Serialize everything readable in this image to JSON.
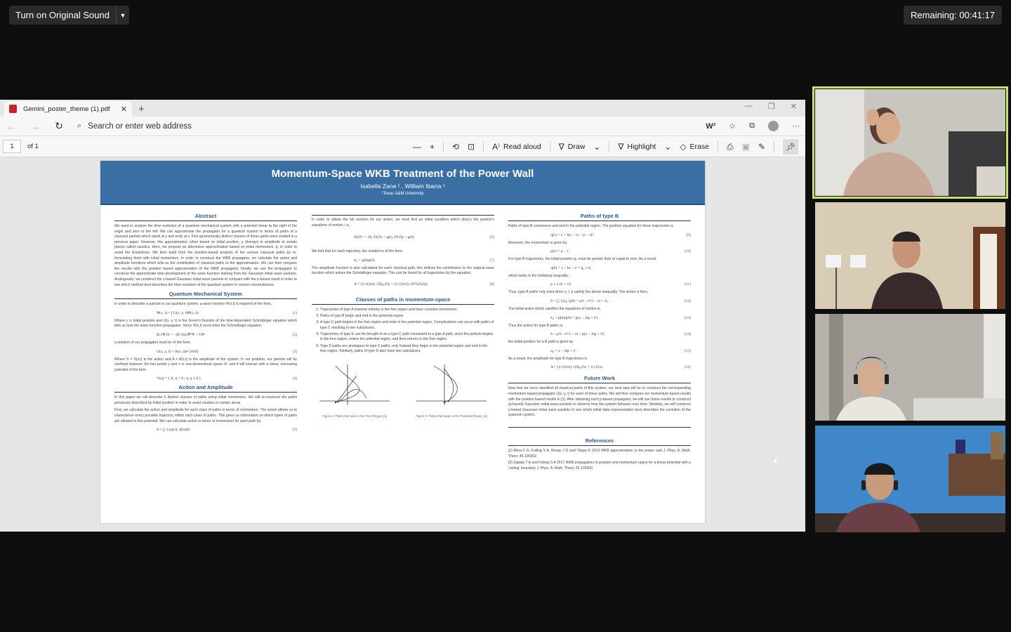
{
  "zoom": {
    "original_sound_label": "Turn on Original Sound",
    "remaining_label": "Remaining: 00:41:17"
  },
  "browser": {
    "tab_title": "Gemini_poster_theme (1).pdf",
    "address_placeholder": "Search or enter web address",
    "page_number": "1",
    "page_of": "of 1",
    "tools": {
      "read_aloud": "Read aloud",
      "draw": "Draw",
      "highlight": "Highlight",
      "erase": "Erase"
    }
  },
  "poster": {
    "title": "Momentum-Space WKB Treatment of the Power Wall",
    "authors": "Isabella Zane ¹ , William Ibarra ¹",
    "affiliation": "¹Texas A&M University",
    "sections": {
      "abstract": {
        "heading": "Abstract",
        "text": "We want to analyze the time evolution of a quantum mechanical system with a potential linear to the right of the origin and zero to the left. We can approximate the propagator for a quantum system in terms of paths of a classical particle which starts at y and ends at x. Five geometrically distinct classes of these paths were studied in a previous paper. However, this approximation, when based on initial position, y, diverges in amplitude at certain places called caustics. Here, we propose an alternative approximation based on initial momentum, p, in order to avoid the breakdown. We then build from the position-based analysis of the various classical paths by re-formulating them with initial momentum. In order to construct the WKB propagator, we calculate the action and amplitude functions which tells us the contribution of classical paths to the approximation. We can then compare the results with the position based approximation of the WKB propagator. Finally, we use the propagator to construct the approximate time-development of the wave function starting from the Gaussian initial wave packets. Analogously, we construct the y-based Gaussian initial wave packets to compare with the p-based result in order to see which method best describes the time evolution of the quantum system in various circumstances."
      },
      "qms": {
        "heading": "Quantum Mechanical System",
        "p1": "In order to describe a particle in our quantum system, a wave function Ψ(x,t) is required of the form,",
        "eq1": "Ψ(x, t) = ∫ U(x, y, t)Ψ(y, 0)",
        "eq1_n": "[1]",
        "p2": "Where y is initial position and U(x, y, t) is the Green's function of the time-dependent Schrödinger equation which tells us how the wave function propagates. Since Ψ(x,t) must solve the Schrödinger equation,",
        "eq2": "iħ ∂Ψ/∂t = −(ħ²/2m)∇²Ψ + VΨ",
        "eq2_n": "[2]",
        "p3": "a solution of our propagator must be of the form,",
        "eq3": "U(x, y, t) = A(x, t)e^{iS/ħ}",
        "eq3_n": "[3]",
        "p4": "Where S = S(x,t) is the action and A = A(x,t) is the amplitude of the system. In our problem, our particle will be confined between the two points y and x in one-dimensional space ℝ¹ and it will interact with a linear, increasing potential of the form",
        "eq4": "V(q) = { 0, q < 0 ; q, q ≥ 0 }",
        "eq4_n": "[4]"
      },
      "action": {
        "heading": "Action and Amplitude",
        "p1": "In this paper we will describe 5 distinct classes of paths using initial momentum. We will re-construct the paths previously described by initial position in order to avoid caustics in certain areas.",
        "p2": "First, we calculate the action and amplitude for each class of paths in terms of momentum. The action allows us to characterize every possible trajectory within each class of paths. This gives us information on which types of paths are allowed in this potential. We can calculate action in terms of momentum for each path by,",
        "eq5": "S = ∫₀ᵗ L(q(τ), q̇(τ))dτ",
        "eq5_n": "[5]"
      },
      "col2": {
        "p1": "In order to obtain the full solution for our action, we must find an initial condition which obey's the particle's equations of motion, i.e,",
        "eq6": "∂S/∂t = −H,  ∂S/∂x = p(t),  ∂S/∂p = q(0)",
        "eq6_n": "[6]",
        "p2": "We find that for each trajectory, the solution is of the form,",
        "eq7": "S₀ = q(0)p(0)",
        "eq7_n": "[7]",
        "p3": "The amplitude function is also calculated for each classical path, this defines the contribution to the original wave function which solves the Schrödinger equation. This can be found for all trajectories by the equation,",
        "eq8": "A = (1/√(2π)) √|∂p₀/∂x| = (1/√(2π)) √|∂²S/∂x∂p|",
        "eq8_n": "[8]"
      },
      "classes": {
        "heading": "Classes of paths in momentum-space",
        "items": [
          "Trajectories of type A traverse entirely in the free region and have constant momentum.",
          "Paths of type B begin and end in the potential region.",
          "A type C path begins in the free region and ends in the potential region. Complications can occur with paths of type C resulting in two subclasses.",
          "Trajectories of type E can be thought of as a type C path connected to a type A path, since the particle begins in the free region, enters the potential region, and then returns to the free region.",
          "Type D paths are analogous to type C paths, only instead they begin in the potential region and end in the free region. Similarly, paths of type D also have two subclasses."
        ],
        "fig1_caption": "Figure 1: Paths that start in the Free Region [1]",
        "fig2_caption": "Figure 2: Paths that begin in the Potential Region [1]"
      },
      "typeb": {
        "heading": "Paths of type B",
        "p1": "Paths of type B commence and end in the potential region. The position equation for these trajectories is",
        "eq9": "q(τ) = x + b(τ − t) − (τ − t)².",
        "eq9_n": "[9]",
        "p2": "Moreover, the momentum is given by",
        "eq10": "p(τ) = p − τ.",
        "eq10_n": "[10]",
        "p3": "For type B trajectories, the initial position q₀ must be greater than or equal to zero. As a result,",
        "eq10b": "q(0) = x − bt − t² = q₀ ≥ 0,",
        "p4": "which leads to the following inequality:",
        "eq11": "p ≤ x/2t + t/2",
        "eq11_n": "[11]",
        "p5": "Thus, type B paths only exist when x, t, p satisfy the above inequality. The action is then,",
        "eq12": "S = ∫₀ᵗ L(q, q̇)dτ = p²t − t³/3 − xt + S₀",
        "eq12_n": "[12]",
        "p6": "The initial action which satisfies the equations of motion is,",
        "eq13": "S₀ = p(0)q(0) = p(x − 2tp + t²)",
        "eq13_n": "[13]",
        "p7": "Thus the action for type B paths is,",
        "eq14": "S = p²t − t³/3 − xt + p(x − 2tp + t²)",
        "eq14_n": "[14]",
        "p8": "the initial position for a B path is given by",
        "eq15": "q₀ = x − 2tp + t².",
        "eq15_n": "[15]",
        "p9": "As a result, the amplitude for type B trajectories is",
        "eq16": "A = (1/√(2π)) √|∂p₀/∂x| = 1/√(2π)",
        "eq16_n": "[16]"
      },
      "future": {
        "heading": "Future Work",
        "text": "Now that we have classified all classical paths of this system, our next step will be to construct the corresponding momentum based propagator U(x, y, t) for each of these paths. We will then compare our momentum based results with the position based results in [1]. After obtaining each p-based propagator, we will use these results to construct (p-based) Gaussian initial wave packets to observe how the system behaves over time. Similarly, we will construct y-based Gaussian initial wave packets to see which initial data representation best describes the evolution of the quantum system."
      },
      "refs": {
        "heading": "References",
        "r1": "[1] Mera F D, Fulling S A, Bouas J D and Thapa K 2013 WKB approximation to the power wall J. Phys. A: Math. Theor. 46 195302",
        "r2": "[2] Zapata T A and Fulling S A 2017 WKB propagators in position and momentum space for a linear potential with a 'ceiling' boundary J. Phys. A: Math. Theor. 50 105303"
      }
    }
  },
  "colors": {
    "poster_header": "#3a6fa4",
    "active_speaker_border": "#c6e462",
    "pdf_icon": "#c4262e"
  }
}
